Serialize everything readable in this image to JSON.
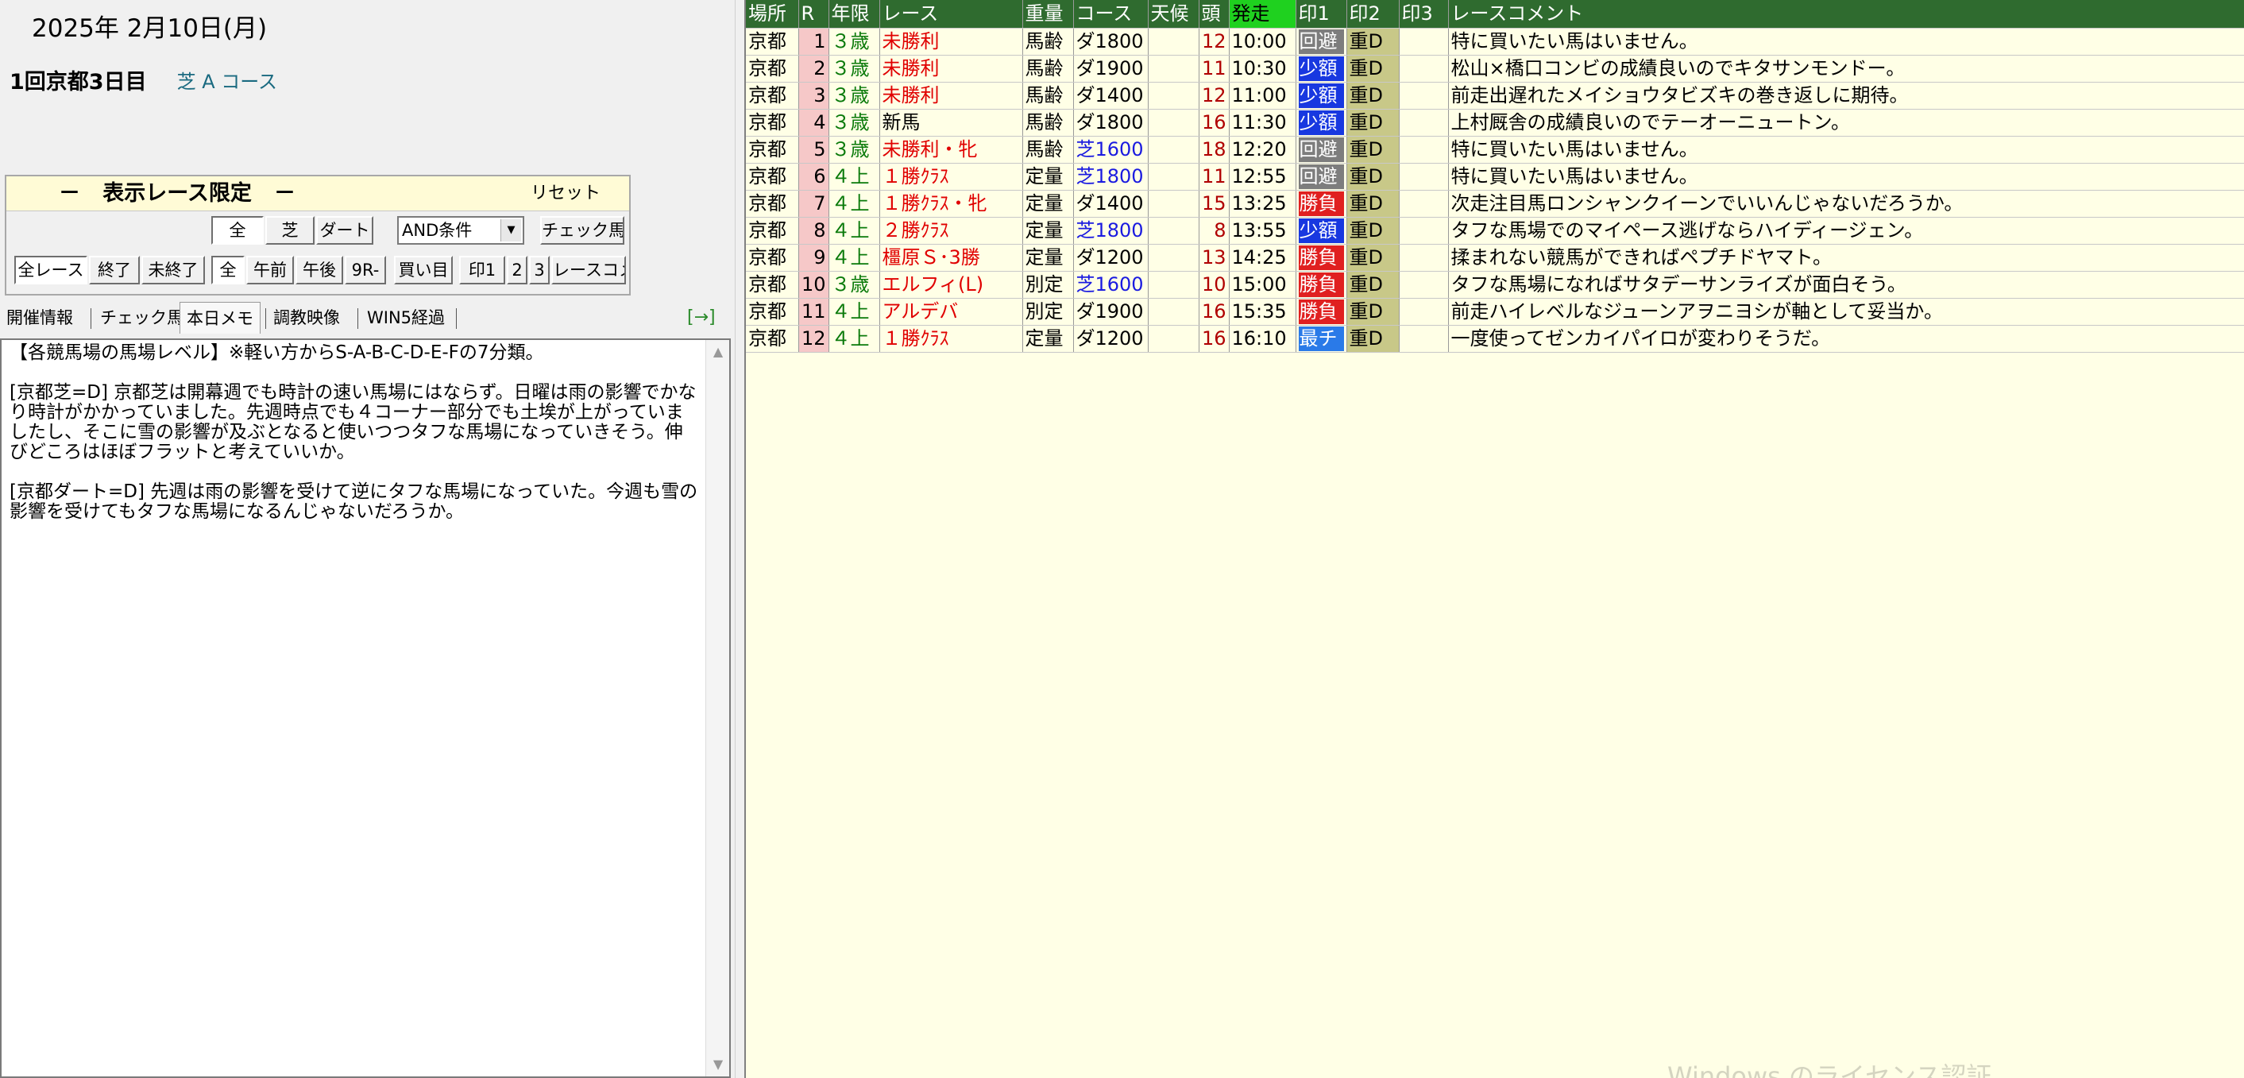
{
  "header": {
    "date": "2025年  2月10日(月)",
    "meeting": "1回京都3日目",
    "course": "芝 A コース"
  },
  "filter": {
    "title": "－   表示レース限定   －",
    "reset": "リセット",
    "surface_buttons": [
      "全",
      "芝",
      "ダート"
    ],
    "condition_select": "AND条件",
    "check_horse": "チェック馬",
    "row2": [
      "全レース",
      "終了",
      "未終了",
      "全",
      "午前",
      "午後",
      "9R-",
      "買い目",
      "印1",
      "2",
      "3",
      "レースコメ"
    ]
  },
  "tabs": [
    "開催情報",
    "チェック馬",
    "本日メモ",
    "調教映像",
    "WIN5経過"
  ],
  "tab_arrow": "[→]",
  "memo": "【各競馬場の馬場レベル】※軽い方からS-A-B-C-D-E-Fの7分類。\n\n[京都芝=D] 京都芝は開幕週でも時計の速い馬場にはならず。日曜は雨の影響でかなり時計がかかっていました。先週時点でも４コーナー部分でも土埃が上がっていましたし、そこに雪の影響が及ぶとなると使いつつタフな馬場になっていきそう。伸びどころはほぼフラットと考えていいか。\n\n[京都ダート=D] 先週は雨の影響を受けて逆にタフな馬場になっていた。今週も雪の影響を受けてもタフな馬場になるんじゃないだろうか。",
  "table": {
    "columns": [
      "場所",
      "R",
      "年限",
      "レース",
      "重量",
      "コース",
      "天候",
      "頭",
      "発走",
      "印1",
      "印2",
      "印3",
      "レースコメント"
    ],
    "rows": [
      {
        "place": "京都",
        "r": "1",
        "age": "３歳",
        "race": "未勝利",
        "weight": "馬齢",
        "course": "ダ1800",
        "weather": "",
        "heads": "12",
        "time": "10:00",
        "m1": "回避",
        "m2": "重D",
        "m3": "",
        "comment": "特に買いたい馬はいません。"
      },
      {
        "place": "京都",
        "r": "2",
        "age": "３歳",
        "race": "未勝利",
        "weight": "馬齢",
        "course": "ダ1900",
        "weather": "",
        "heads": "11",
        "time": "10:30",
        "m1": "少額",
        "m2": "重D",
        "m3": "",
        "comment": "松山×橋口コンビの成績良いのでキタサンモンドー。"
      },
      {
        "place": "京都",
        "r": "3",
        "age": "３歳",
        "race": "未勝利",
        "weight": "馬齢",
        "course": "ダ1400",
        "weather": "",
        "heads": "12",
        "time": "11:00",
        "m1": "少額",
        "m2": "重D",
        "m3": "",
        "comment": "前走出遅れたメイショウタビズキの巻き返しに期待。"
      },
      {
        "place": "京都",
        "r": "4",
        "age": "３歳",
        "race": "新馬",
        "weight": "馬齢",
        "course": "ダ1800",
        "weather": "",
        "heads": "16",
        "time": "11:30",
        "m1": "少額",
        "m2": "重D",
        "m3": "",
        "comment": "上村厩舎の成績良いのでテーオーニュートン。"
      },
      {
        "place": "京都",
        "r": "5",
        "age": "３歳",
        "race": "未勝利・牝",
        "weight": "馬齢",
        "course": "芝1600",
        "weather": "",
        "heads": "18",
        "time": "12:20",
        "m1": "回避",
        "m2": "重D",
        "m3": "",
        "comment": "特に買いたい馬はいません。"
      },
      {
        "place": "京都",
        "r": "6",
        "age": "４上",
        "race": "１勝ｸﾗｽ",
        "weight": "定量",
        "course": "芝1800",
        "weather": "",
        "heads": "11",
        "time": "12:55",
        "m1": "回避",
        "m2": "重D",
        "m3": "",
        "comment": "特に買いたい馬はいません。"
      },
      {
        "place": "京都",
        "r": "7",
        "age": "４上",
        "race": "１勝ｸﾗｽ・牝",
        "weight": "定量",
        "course": "ダ1400",
        "weather": "",
        "heads": "15",
        "time": "13:25",
        "m1": "勝負",
        "m2": "重D",
        "m3": "",
        "comment": "次走注目馬ロンシャンクイーンでいいんじゃないだろうか。"
      },
      {
        "place": "京都",
        "r": "8",
        "age": "４上",
        "race": "２勝ｸﾗｽ",
        "weight": "定量",
        "course": "芝1800",
        "weather": "",
        "heads": "8",
        "time": "13:55",
        "m1": "少額",
        "m2": "重D",
        "m3": "",
        "comment": "タフな馬場でのマイペース逃げならハイディージェン。"
      },
      {
        "place": "京都",
        "r": "9",
        "age": "４上",
        "race": "橿原Ｓ･3勝",
        "weight": "定量",
        "course": "ダ1200",
        "weather": "",
        "heads": "13",
        "time": "14:25",
        "m1": "勝負",
        "m2": "重D",
        "m3": "",
        "comment": "揉まれない競馬ができればペプチドヤマト。"
      },
      {
        "place": "京都",
        "r": "10",
        "age": "３歳",
        "race": "エルフィ(L)",
        "weight": "別定",
        "course": "芝1600",
        "weather": "",
        "heads": "10",
        "time": "15:00",
        "m1": "勝負",
        "m2": "重D",
        "m3": "",
        "comment": "タフな馬場になればサタデーサンライズが面白そう。"
      },
      {
        "place": "京都",
        "r": "11",
        "age": "４上",
        "race": "アルデバ",
        "weight": "別定",
        "course": "ダ1900",
        "weather": "",
        "heads": "16",
        "time": "15:35",
        "m1": "勝負",
        "m2": "重D",
        "m3": "",
        "comment": "前走ハイレベルなジューンアヲニヨシが軸として妥当か。"
      },
      {
        "place": "京都",
        "r": "12",
        "age": "４上",
        "race": "１勝ｸﾗｽ",
        "weight": "定量",
        "course": "ダ1200",
        "weather": "",
        "heads": "16",
        "time": "16:10",
        "m1": "最チ",
        "m2": "重D",
        "m3": "",
        "comment": "一度使ってゼンカイパイロが変わりそうだ。"
      }
    ]
  },
  "colors": {
    "header_bg": "#2f6b2f",
    "header_highlight": "#1fd11f",
    "row_bg": "#ffffe6",
    "r_cell_bg": "#f6c8c8",
    "m2_bg": "#c8c888",
    "avoid": "#7d7d7d",
    "small": "#1838e0",
    "win": "#e02020",
    "best": "#2a7ae8"
  }
}
